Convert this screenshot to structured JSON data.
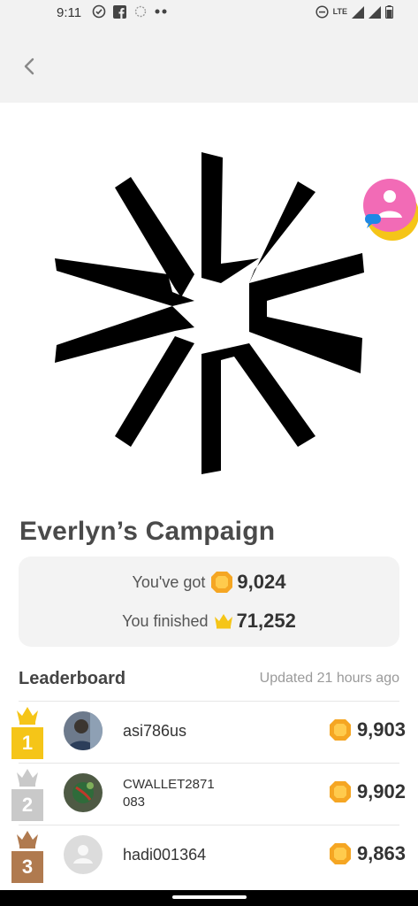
{
  "status_bar": {
    "time": "9:11",
    "network": "LTE",
    "left_icons": [
      "check-circle-icon",
      "facebook-icon",
      "signal-app-icon",
      "more-dots-icon"
    ],
    "right_icons": [
      "do-not-disturb-icon",
      "lte-icon",
      "signal-icon",
      "signal-icon",
      "battery-icon"
    ]
  },
  "app_bar": {
    "back_icon": "chevron-left-icon"
  },
  "campaign": {
    "title": "Everlyn’s Campaign",
    "got_label": "You've got",
    "got_value": "9,024",
    "finished_label": "You finished",
    "finished_value": "71,252"
  },
  "leaderboard": {
    "title": "Leaderboard",
    "updated": "Updated 21 hours ago",
    "rows": [
      {
        "rank": "1",
        "name": "asi786us",
        "score": "9,903",
        "rank_color": "#f5c518",
        "crown_color": "#f5c518"
      },
      {
        "rank": "2",
        "name": "CWALLET2871 083",
        "score": "9,902",
        "rank_color": "#c9c9c9",
        "crown_color": "#c9c9c9"
      },
      {
        "rank": "3",
        "name": "hadi001364",
        "score": "9,863",
        "rank_color": "#b07a4f",
        "crown_color": "#b07a4f"
      }
    ]
  },
  "colors": {
    "gem": "#f5a623",
    "crown_gold": "#f5c518",
    "chat_head": "#f26bb6"
  }
}
